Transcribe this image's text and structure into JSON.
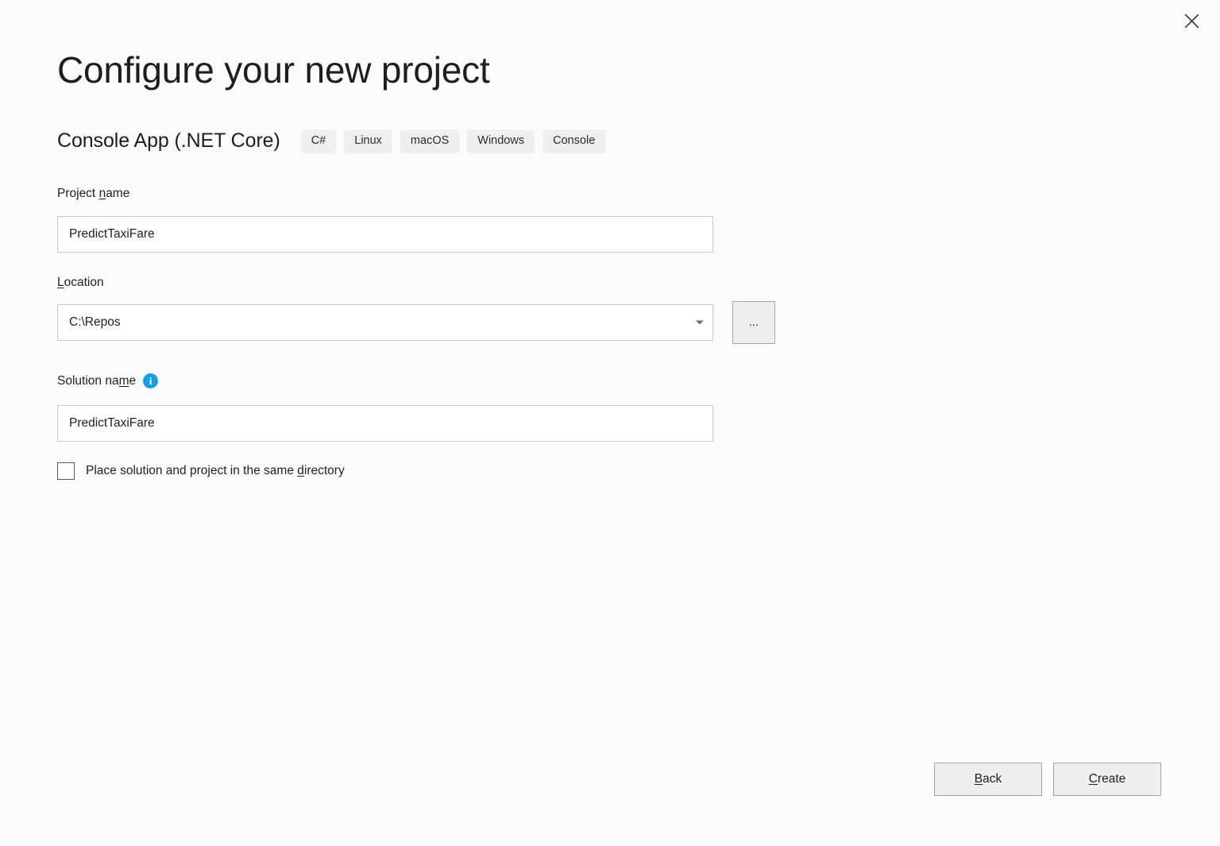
{
  "window": {
    "close_label": "×",
    "close_icon": "close-icon"
  },
  "header": {
    "title": "Configure your new project",
    "template_name": "Console App (.NET Core)",
    "tags": [
      "C#",
      "Linux",
      "macOS",
      "Windows",
      "Console"
    ]
  },
  "form": {
    "project_name": {
      "label_before": "Project ",
      "label_accel": "n",
      "label_after": "ame",
      "value": "PredictTaxiFare",
      "placeholder": ""
    },
    "location": {
      "label_accel": "L",
      "label_after": "ocation",
      "value": "C:\\Repos",
      "placeholder": "",
      "browse_label": "...",
      "dropdown_icon": "chevron-down-icon"
    },
    "solution_name": {
      "label_before": "Solution na",
      "label_accel": "m",
      "label_after": "e",
      "value": "PredictTaxiFare",
      "placeholder": "",
      "info_icon": "info-icon",
      "info_glyph": "i"
    },
    "same_directory_checkbox": {
      "label_before": "Place solution and project in the same ",
      "label_accel": "d",
      "label_after": "irectory",
      "checked": false
    }
  },
  "footer": {
    "back": {
      "accel": "B",
      "rest": "ack"
    },
    "create": {
      "accel": "C",
      "rest": "reate"
    }
  },
  "colors": {
    "background": "#fbfbfb",
    "text": "#1f1f1f",
    "tag_background": "#efefef",
    "input_border": "#c9c9c9",
    "button_face": "#efefef",
    "button_border": "#a5a5a5",
    "info_blue": "#1a9ee0"
  }
}
